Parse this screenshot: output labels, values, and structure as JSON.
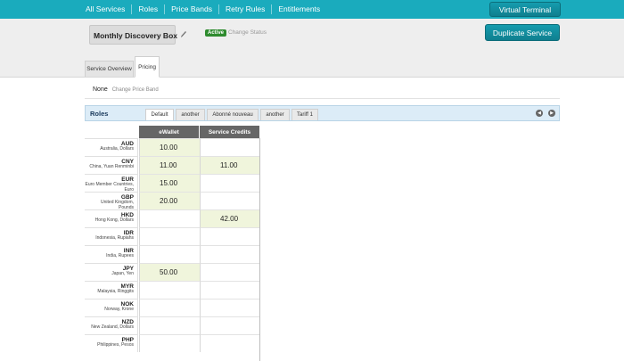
{
  "nav": {
    "items": [
      "All Services",
      "Roles",
      "Price Bands",
      "Retry Rules",
      "Entitlements"
    ],
    "virtual_terminal": "Virtual Terminal"
  },
  "service": {
    "name": "Monthly Discovery Box",
    "status": "Active",
    "change_status": "Change Status",
    "duplicate": "Duplicate Service"
  },
  "tabs": [
    "Service Overview",
    "Pricing"
  ],
  "price_band": {
    "value": "None",
    "change_link": "Change Price Band"
  },
  "roles": {
    "label": "Roles",
    "tabs": [
      "Default",
      "another",
      "Abonné nouveau",
      "another",
      "Tariff 1"
    ],
    "active_tab": "Default"
  },
  "grid": {
    "columns": [
      "eWallet",
      "Service Credits"
    ],
    "rows": [
      {
        "code": "AUD",
        "desc": "Australia, Dollars",
        "ewallet": "10.00",
        "credits": ""
      },
      {
        "code": "CNY",
        "desc": "China, Yuan Renminbi",
        "ewallet": "11.00",
        "credits": "11.00"
      },
      {
        "code": "EUR",
        "desc": "Euro Member Countries, Euro",
        "ewallet": "15.00",
        "credits": ""
      },
      {
        "code": "GBP",
        "desc": "United Kingdom, Pounds",
        "ewallet": "20.00",
        "credits": ""
      },
      {
        "code": "HKD",
        "desc": "Hong Kong, Dollars",
        "ewallet": "",
        "credits": "42.00"
      },
      {
        "code": "IDR",
        "desc": "Indonesia, Rupiahs",
        "ewallet": "",
        "credits": ""
      },
      {
        "code": "INR",
        "desc": "India, Rupees",
        "ewallet": "",
        "credits": ""
      },
      {
        "code": "JPY",
        "desc": "Japan, Yen",
        "ewallet": "50.00",
        "credits": ""
      },
      {
        "code": "MYR",
        "desc": "Malaysia, Ringgits",
        "ewallet": "",
        "credits": ""
      },
      {
        "code": "NOK",
        "desc": "Norway, Krone",
        "ewallet": "",
        "credits": ""
      },
      {
        "code": "NZD",
        "desc": "New Zealand, Dollars",
        "ewallet": "",
        "credits": ""
      },
      {
        "code": "PHP",
        "desc": "Philippines, Pesos",
        "ewallet": "",
        "credits": ""
      }
    ]
  },
  "colors": {
    "nav_bg": "#1aabbd",
    "button": "#0f8a9c",
    "active_badge": "#2e8b2e",
    "filled_cell": "#f0f5dc",
    "grid_header": "#666666"
  }
}
